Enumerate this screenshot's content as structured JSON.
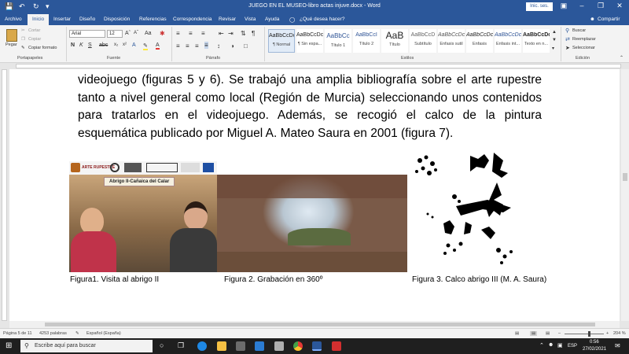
{
  "titlebar": {
    "title": "JUEGO EN EL MUSEO-libro actas injuve.docx  -  Word",
    "signin": "Inic. ses."
  },
  "tabs": [
    "Archivo",
    "Inicio",
    "Insertar",
    "Diseño",
    "Disposición",
    "Referencias",
    "Correspondencia",
    "Revisar",
    "Vista",
    "Ayuda"
  ],
  "tell_me": "¿Qué desea hacer?",
  "share": "Compartir",
  "ribbon": {
    "clipboard": {
      "paste": "Pegar",
      "cut": "Cortar",
      "copy": "Copiar",
      "format": "Copiar formato",
      "label": "Portapapeles"
    },
    "font": {
      "name": "Arial",
      "size": "12",
      "label": "Fuente"
    },
    "paragraph": {
      "label": "Párrafo"
    },
    "styles": {
      "label": "Estilos",
      "items": [
        {
          "preview": "AaBbCcDc",
          "name": "¶ Normal"
        },
        {
          "preview": "AaBbCcDc",
          "name": "¶ Sin espa..."
        },
        {
          "preview": "AaBbCc",
          "name": "Título 1"
        },
        {
          "preview": "AaBbCcI",
          "name": "Título 2"
        },
        {
          "preview": "AaB",
          "name": "Título"
        },
        {
          "preview": "AaBbCcD",
          "name": "Subtítulo"
        },
        {
          "preview": "AaBbCcDc",
          "name": "Énfasis sutil"
        },
        {
          "preview": "AaBbCcDc",
          "name": "Énfasis"
        },
        {
          "preview": "AaBbCcDc",
          "name": "Énfasis int..."
        },
        {
          "preview": "AaBbCcDc",
          "name": "Texto en n..."
        }
      ]
    },
    "editing": {
      "find": "Buscar",
      "replace": "Reemplazar",
      "select": "Seleccionar",
      "label": "Edición"
    }
  },
  "document": {
    "paragraph": "videojuego (figuras 5 y 6). Se trabajó una amplia bibliografía sobre el arte rupestre tanto a nivel general como local (Región de Murcia) seleccionando unos contenidos para tratarlos en el videojuego. Además, se recogió el calco de la pintura esquemática publicado por Miguel A. Mateo Saura en 2001 (figura 7).",
    "photo_banner": "Abrigo II-Cañaica del Calar",
    "logo_text": "ARTE RUPESTRE",
    "captions": [
      "Figura1. Visita al abrigo II",
      "Figura 2. Grabación en 360º",
      "Figura 3. Calco abrigo III (M. A. Saura)"
    ]
  },
  "status": {
    "page": "Página 5 de 11",
    "words": "4253 palabras",
    "language": "Español (España)",
    "zoom": "204 %"
  },
  "taskbar": {
    "search_placeholder": "Escribe aquí para buscar",
    "lang": "ESP",
    "time": "0:56",
    "date": "27/02/2021"
  },
  "colors": {
    "accent": "#2b579a"
  }
}
